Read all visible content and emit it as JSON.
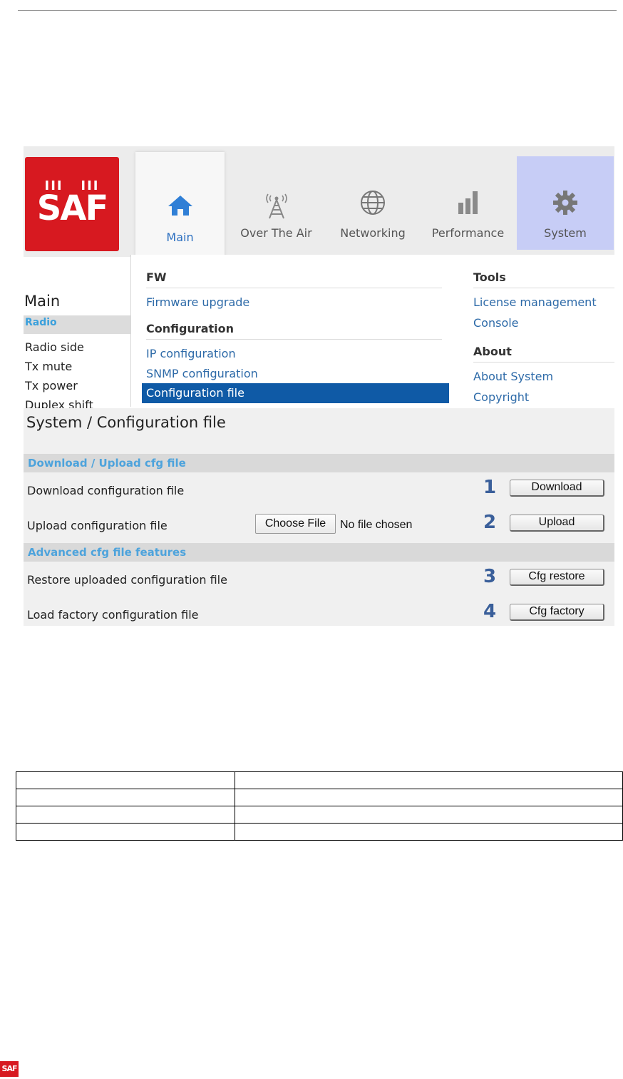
{
  "brand": {
    "logo_text": "SAF",
    "accent": "#d71920"
  },
  "tabs": [
    {
      "label": "Main",
      "icon": "home-icon",
      "active": true
    },
    {
      "label": "Over The Air",
      "icon": "antenna-icon"
    },
    {
      "label": "Networking",
      "icon": "globe-icon"
    },
    {
      "label": "Performance",
      "icon": "bar-chart-icon"
    },
    {
      "label": "System",
      "icon": "gear-icon",
      "highlighted": true
    }
  ],
  "leftnav": {
    "title": "Main",
    "selected": "Radio",
    "items": [
      "Radio side",
      "Tx mute",
      "Tx power",
      "Duplex shift"
    ]
  },
  "menu": {
    "fw_head": "FW",
    "fw_items": [
      "Firmware upgrade"
    ],
    "config_head": "Configuration",
    "config_items": [
      "IP configuration",
      "SNMP configuration",
      "Configuration file"
    ],
    "tools_head": "Tools",
    "tools_items": [
      "License management",
      "Console"
    ],
    "about_head": "About",
    "about_items": [
      "About System",
      "Copyright"
    ]
  },
  "content": {
    "title": "System / Configuration file",
    "section1": "Download / Upload cfg file",
    "section2": "Advanced cfg file features",
    "rows": [
      {
        "label": "Download configuration file",
        "num": "1",
        "button": "Download"
      },
      {
        "label": "Upload configuration file",
        "num": "2",
        "button": "Upload"
      },
      {
        "label": "Restore uploaded configuration file",
        "num": "3",
        "button": "Cfg restore"
      },
      {
        "label": "Load factory configuration file",
        "num": "4",
        "button": "Cfg factory"
      }
    ],
    "choose_file": "Choose File",
    "no_file": "No file chosen"
  },
  "footer": {
    "logo_text": "SAF"
  }
}
